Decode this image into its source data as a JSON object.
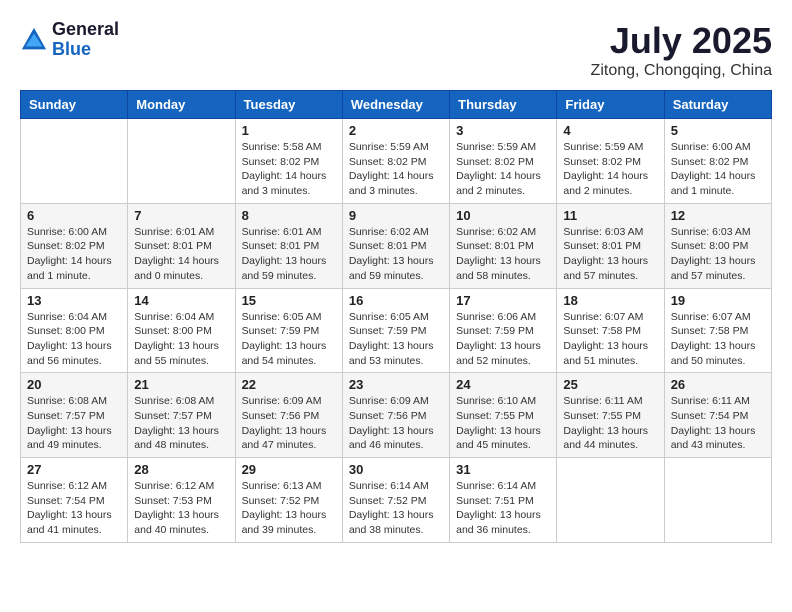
{
  "header": {
    "logo_general": "General",
    "logo_blue": "Blue",
    "title": "July 2025",
    "subtitle": "Zitong, Chongqing, China"
  },
  "days_of_week": [
    "Sunday",
    "Monday",
    "Tuesday",
    "Wednesday",
    "Thursday",
    "Friday",
    "Saturday"
  ],
  "weeks": [
    [
      {
        "day": "",
        "info": ""
      },
      {
        "day": "",
        "info": ""
      },
      {
        "day": "1",
        "info": "Sunrise: 5:58 AM\nSunset: 8:02 PM\nDaylight: 14 hours and 3 minutes."
      },
      {
        "day": "2",
        "info": "Sunrise: 5:59 AM\nSunset: 8:02 PM\nDaylight: 14 hours and 3 minutes."
      },
      {
        "day": "3",
        "info": "Sunrise: 5:59 AM\nSunset: 8:02 PM\nDaylight: 14 hours and 2 minutes."
      },
      {
        "day": "4",
        "info": "Sunrise: 5:59 AM\nSunset: 8:02 PM\nDaylight: 14 hours and 2 minutes."
      },
      {
        "day": "5",
        "info": "Sunrise: 6:00 AM\nSunset: 8:02 PM\nDaylight: 14 hours and 1 minute."
      }
    ],
    [
      {
        "day": "6",
        "info": "Sunrise: 6:00 AM\nSunset: 8:02 PM\nDaylight: 14 hours and 1 minute."
      },
      {
        "day": "7",
        "info": "Sunrise: 6:01 AM\nSunset: 8:01 PM\nDaylight: 14 hours and 0 minutes."
      },
      {
        "day": "8",
        "info": "Sunrise: 6:01 AM\nSunset: 8:01 PM\nDaylight: 13 hours and 59 minutes."
      },
      {
        "day": "9",
        "info": "Sunrise: 6:02 AM\nSunset: 8:01 PM\nDaylight: 13 hours and 59 minutes."
      },
      {
        "day": "10",
        "info": "Sunrise: 6:02 AM\nSunset: 8:01 PM\nDaylight: 13 hours and 58 minutes."
      },
      {
        "day": "11",
        "info": "Sunrise: 6:03 AM\nSunset: 8:01 PM\nDaylight: 13 hours and 57 minutes."
      },
      {
        "day": "12",
        "info": "Sunrise: 6:03 AM\nSunset: 8:00 PM\nDaylight: 13 hours and 57 minutes."
      }
    ],
    [
      {
        "day": "13",
        "info": "Sunrise: 6:04 AM\nSunset: 8:00 PM\nDaylight: 13 hours and 56 minutes."
      },
      {
        "day": "14",
        "info": "Sunrise: 6:04 AM\nSunset: 8:00 PM\nDaylight: 13 hours and 55 minutes."
      },
      {
        "day": "15",
        "info": "Sunrise: 6:05 AM\nSunset: 7:59 PM\nDaylight: 13 hours and 54 minutes."
      },
      {
        "day": "16",
        "info": "Sunrise: 6:05 AM\nSunset: 7:59 PM\nDaylight: 13 hours and 53 minutes."
      },
      {
        "day": "17",
        "info": "Sunrise: 6:06 AM\nSunset: 7:59 PM\nDaylight: 13 hours and 52 minutes."
      },
      {
        "day": "18",
        "info": "Sunrise: 6:07 AM\nSunset: 7:58 PM\nDaylight: 13 hours and 51 minutes."
      },
      {
        "day": "19",
        "info": "Sunrise: 6:07 AM\nSunset: 7:58 PM\nDaylight: 13 hours and 50 minutes."
      }
    ],
    [
      {
        "day": "20",
        "info": "Sunrise: 6:08 AM\nSunset: 7:57 PM\nDaylight: 13 hours and 49 minutes."
      },
      {
        "day": "21",
        "info": "Sunrise: 6:08 AM\nSunset: 7:57 PM\nDaylight: 13 hours and 48 minutes."
      },
      {
        "day": "22",
        "info": "Sunrise: 6:09 AM\nSunset: 7:56 PM\nDaylight: 13 hours and 47 minutes."
      },
      {
        "day": "23",
        "info": "Sunrise: 6:09 AM\nSunset: 7:56 PM\nDaylight: 13 hours and 46 minutes."
      },
      {
        "day": "24",
        "info": "Sunrise: 6:10 AM\nSunset: 7:55 PM\nDaylight: 13 hours and 45 minutes."
      },
      {
        "day": "25",
        "info": "Sunrise: 6:11 AM\nSunset: 7:55 PM\nDaylight: 13 hours and 44 minutes."
      },
      {
        "day": "26",
        "info": "Sunrise: 6:11 AM\nSunset: 7:54 PM\nDaylight: 13 hours and 43 minutes."
      }
    ],
    [
      {
        "day": "27",
        "info": "Sunrise: 6:12 AM\nSunset: 7:54 PM\nDaylight: 13 hours and 41 minutes."
      },
      {
        "day": "28",
        "info": "Sunrise: 6:12 AM\nSunset: 7:53 PM\nDaylight: 13 hours and 40 minutes."
      },
      {
        "day": "29",
        "info": "Sunrise: 6:13 AM\nSunset: 7:52 PM\nDaylight: 13 hours and 39 minutes."
      },
      {
        "day": "30",
        "info": "Sunrise: 6:14 AM\nSunset: 7:52 PM\nDaylight: 13 hours and 38 minutes."
      },
      {
        "day": "31",
        "info": "Sunrise: 6:14 AM\nSunset: 7:51 PM\nDaylight: 13 hours and 36 minutes."
      },
      {
        "day": "",
        "info": ""
      },
      {
        "day": "",
        "info": ""
      }
    ]
  ]
}
